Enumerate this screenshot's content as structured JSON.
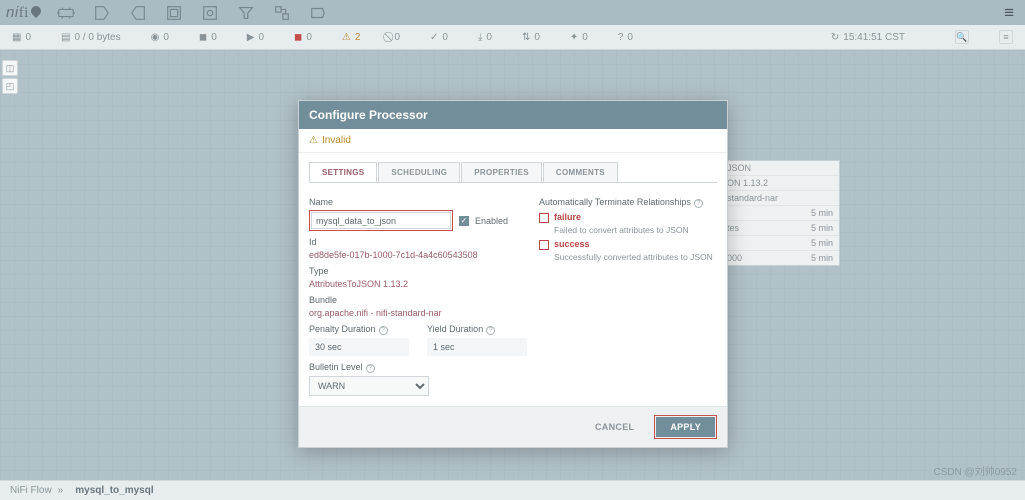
{
  "app": {
    "name": "nifi"
  },
  "status": {
    "queued_count": "0",
    "queued_bytes": "0 / 0 bytes",
    "in": "0",
    "rw": "0",
    "out": "0",
    "running": "0",
    "stopped": "0",
    "invalid": "2",
    "disabled": "0",
    "uptodate": "0",
    "stale": "0",
    "sync": "0",
    "locally_mod": "0",
    "ver": "0",
    "refresh": "15:41:51 CST"
  },
  "ghost": {
    "title": "JSON",
    "ver": "ON 1.13.2",
    "bundle": "standard-nar",
    "r1": "tes",
    "r2": "000",
    "v": "5 min"
  },
  "breadcrumb": {
    "root": "NiFi Flow",
    "sep": "»",
    "current": "mysql_to_mysql"
  },
  "modal": {
    "title": "Configure Processor",
    "alert": "Invalid",
    "tabs": {
      "settings": "SETTINGS",
      "scheduling": "SCHEDULING",
      "properties": "PROPERTIES",
      "comments": "COMMENTS"
    },
    "name_label": "Name",
    "name_value": "mysql_data_to_json",
    "enabled_label": "Enabled",
    "id_label": "Id",
    "id_value": "ed8de5fe-017b-1000-7c1d-4a4c60543508",
    "type_label": "Type",
    "type_value": "AttributesToJSON 1.13.2",
    "bundle_label": "Bundle",
    "bundle_value": "org.apache.nifi - nifi-standard-nar",
    "penalty_label": "Penalty Duration",
    "penalty_value": "30 sec",
    "yield_label": "Yield Duration",
    "yield_value": "1 sec",
    "bulletin_label": "Bulletin Level",
    "bulletin_value": "WARN",
    "rel_label": "Automatically Terminate Relationships",
    "failure": "failure",
    "failure_desc": "Failed to convert attributes to JSON",
    "success": "success",
    "success_desc": "Successfully converted attributes to JSON",
    "cancel": "CANCEL",
    "apply": "APPLY"
  },
  "watermark": "CSDN @刘帅0952"
}
